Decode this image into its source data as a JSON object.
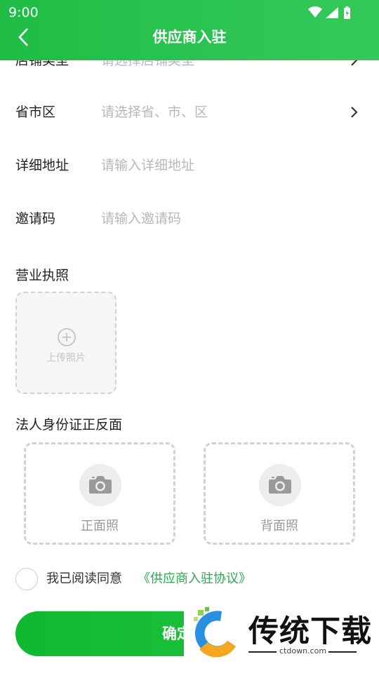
{
  "status_bar": {
    "time": "9:00"
  },
  "header": {
    "title": "供应商入驻"
  },
  "form": {
    "rows": [
      {
        "label": "店铺类型",
        "placeholder": "请选择店铺类型"
      },
      {
        "label": "省市区",
        "placeholder": "请选择省、市、区"
      },
      {
        "label": "详细地址",
        "placeholder": "请输入详细地址"
      },
      {
        "label": "邀请码",
        "placeholder": "请输入邀请码"
      }
    ],
    "license": {
      "label": "营业执照",
      "upload_text": "上传照片"
    },
    "id_card": {
      "label": "法人身份证正反面",
      "front": "正面照",
      "back": "背面照"
    }
  },
  "agreement": {
    "text": "我已阅读同意",
    "link": "《供应商入驻协议》"
  },
  "confirm": {
    "label": "确定"
  },
  "watermark": {
    "title": "传统下载",
    "url": "ctdown.com"
  },
  "colors": {
    "primary": "#1fbd45",
    "link": "#2aa84e",
    "placeholder": "#b8b8b8"
  }
}
